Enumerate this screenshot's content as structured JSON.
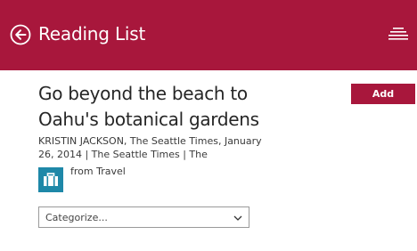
{
  "app": {
    "title": "Reading List",
    "accent_color": "#a8173c",
    "back_icon": "back-arrow-circle-icon",
    "menu_icon": "list-menu-icon"
  },
  "article": {
    "title": "Go beyond the beach to Oahu's botanical gardens",
    "byline": "KRISTIN JACKSON, The Seattle Times, January 26, 2014 | The Seattle Times | The",
    "source_label": "from Travel",
    "source_icon": "suitcase-icon",
    "source_icon_color": "#1e88a8"
  },
  "categorize": {
    "placeholder": "Categorize...",
    "chevron_icon": "chevron-down-icon"
  },
  "actions": {
    "add_label": "Add"
  }
}
